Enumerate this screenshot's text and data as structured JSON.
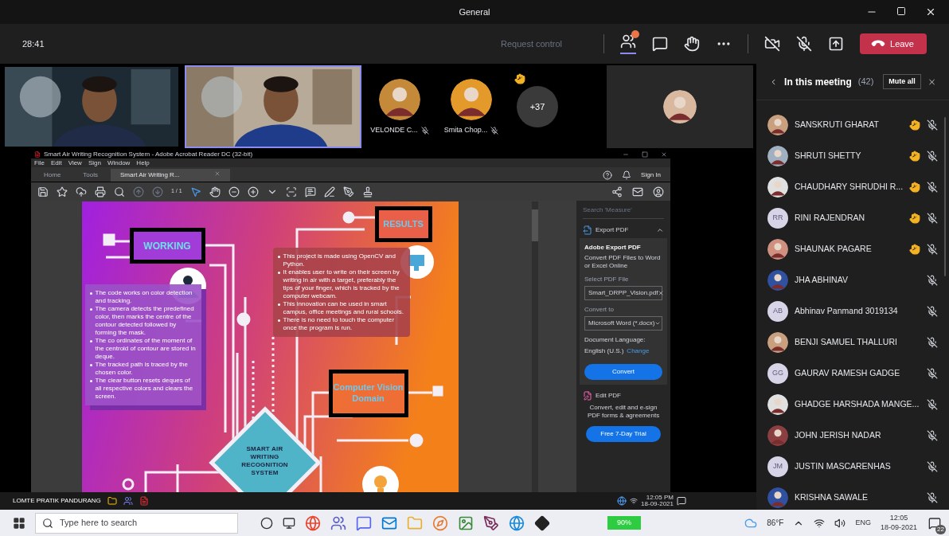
{
  "window": {
    "title": "General"
  },
  "meeting_bar": {
    "timer": "28:41",
    "request_control": "Request control",
    "leave": "Leave"
  },
  "video_row": [
    {
      "kind": "video",
      "selected": false
    },
    {
      "kind": "video",
      "selected": true
    },
    {
      "kind": "avatar",
      "name": "VELONDE C...",
      "selected": false
    },
    {
      "kind": "avatar",
      "name": "Smita Chop...",
      "selected": false
    },
    {
      "kind": "overflow",
      "count": "+37",
      "hand_raised": true,
      "selected": false
    },
    {
      "kind": "avatar_tile",
      "selected": false
    }
  ],
  "shared_screen": {
    "acrobat": {
      "title": "Smart Air Writing Recognition System - Adobe Acrobat Reader DC (32-bit)",
      "menu": [
        "File",
        "Edit",
        "View",
        "Sign",
        "Window",
        "Help"
      ],
      "tabs": [
        {
          "label": "Home",
          "selected": false
        },
        {
          "label": "Tools",
          "selected": false
        },
        {
          "label": "Smart Air Writing R...",
          "selected": true
        }
      ],
      "sign_in": "Sign In",
      "page": "1 / 1",
      "poster": {
        "working_title": "WORKING",
        "results_title": "RESULTS",
        "domain_title": "Computer Vision Domain",
        "center_title": "SMART AIR WRITING RECOGNITION SYSTEM",
        "working_points": [
          "The code works on color detection and tracking.",
          "The camera detects the predefined color, then marks the centre of the contour detected followed by forming the mask.",
          "The co ordinates of the moment of the centroid of contour are stored in deque.",
          "The tracked path is traced by the chosen color.",
          "The clear button resets deques of all respective colors and clears the screen."
        ],
        "results_points": [
          "This project is made using OpenCV and Python.",
          "It enables user to write on their screen by writing in air with a target, preferably the tips of your finger, which is tracked by the computer webcam.",
          "This innovation can be used in smart campus, office meetings and rural schools.",
          "There is no need to touch the computer once the program is run."
        ]
      },
      "side_pane": {
        "search": "Search 'Measure'",
        "export_pdf": "Export PDF",
        "heading": "Adobe Export PDF",
        "subheading": "Convert PDF Files to Word or Excel Online",
        "select_label": "Select PDF File",
        "file": "Smart_DRPP_Vision.pdf",
        "convert_to_label": "Convert to",
        "format": "Microsoft Word (*.docx)",
        "language_label": "Document Language:",
        "language": "English (U.S.)",
        "change": "Change",
        "convert": "Convert",
        "edit_pdf": "Edit PDF",
        "promo": "Convert, edit and e-sign PDF forms & agreements",
        "trial": "Free 7-Day Trial"
      }
    },
    "presenter": "LOMTE PRATIK PANDURANG",
    "tray_time": "12:05 PM",
    "tray_date": "18-09-2021"
  },
  "participants_panel": {
    "title": "In this meeting",
    "count": "(42)",
    "mute_all": "Mute all",
    "participants": [
      {
        "name": "SANSKRUTI GHARAT",
        "hand_raised": true
      },
      {
        "name": "SHRUTI SHETTY",
        "hand_raised": true
      },
      {
        "name": "CHAUDHARY SHRUDHI R...",
        "hand_raised": true
      },
      {
        "name": "RINI RAJENDRAN",
        "initials": "RR",
        "hand_raised": true
      },
      {
        "name": "SHAUNAK PAGARE",
        "hand_raised": true
      },
      {
        "name": "JHA ABHINAV",
        "hand_raised": false
      },
      {
        "name": "Abhinav Panmand 3019134",
        "initials": "AB",
        "hand_raised": false
      },
      {
        "name": "BENJI SAMUEL THALLURI",
        "hand_raised": false
      },
      {
        "name": "GAURAV RAMESH GADGE",
        "initials": "GG",
        "hand_raised": false
      },
      {
        "name": "GHADGE HARSHADA MANGE...",
        "hand_raised": false
      },
      {
        "name": "JOHN JERISH NADAR",
        "hand_raised": false
      },
      {
        "name": "JUSTIN MASCARENHAS",
        "initials": "JM",
        "hand_raised": false
      },
      {
        "name": "KRISHNA SAWALE",
        "hand_raised": false
      }
    ]
  },
  "taskbar": {
    "search_placeholder": "Type here to search",
    "battery": "90%",
    "weather": "86°F",
    "language": "ENG",
    "time": "12:05",
    "date": "18-09-2021",
    "notifications": "22"
  }
}
